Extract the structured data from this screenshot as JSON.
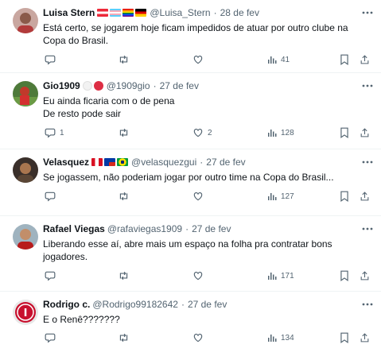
{
  "colors": {
    "text": "#0f1419",
    "secondary": "#536471",
    "divider": "#eff3f4"
  },
  "icons": {
    "more": "more-horizontal-icon",
    "reply": "reply-icon",
    "retweet": "retweet-icon",
    "like": "heart-icon",
    "views": "views-chart-icon",
    "bookmark": "bookmark-icon",
    "share": "share-icon"
  },
  "tweets": [
    {
      "name": "Luisa Stern",
      "badges": [
        "austria-flag",
        "transgender-flag",
        "rainbow-flag",
        "germany-flag"
      ],
      "handle": "@Luisa_Stern",
      "dot": "·",
      "date": "28 de fev",
      "text": "Está certo, se jogarem hoje ficam impedidos de atuar por outro clube na Copa do Brasil.",
      "replies": "",
      "retweets": "",
      "likes": "",
      "views": "41"
    },
    {
      "name": "Gio1909",
      "badges": [
        "white-circle",
        "red-circle"
      ],
      "handle": "@1909gio",
      "dot": "·",
      "date": "27 de fev",
      "text": "Eu ainda ficaria com o de pena\nDe resto pode sair",
      "replies": "1",
      "retweets": "",
      "likes": "2",
      "views": "128"
    },
    {
      "name": "Velasquez",
      "badges": [
        "peru-flag",
        "chile-flag",
        "brazil-flag"
      ],
      "handle": "@velasquezgui",
      "dot": "·",
      "date": "27 de fev",
      "text": "Se jogassem, não poderiam jogar por outro time na Copa do Brasil...",
      "replies": "",
      "retweets": "",
      "likes": "",
      "views": "127"
    },
    {
      "name": "Rafael Viegas",
      "badges": [],
      "handle": "@rafaviegas1909",
      "dot": "·",
      "date": "27 de fev",
      "text": "Liberando esse aí, abre mais um espaço na folha pra contratar bons jogadores.",
      "replies": "",
      "retweets": "",
      "likes": "",
      "views": "171"
    },
    {
      "name": "Rodrigo c.",
      "badges": [],
      "handle": "@Rodrigo99182642",
      "dot": "·",
      "date": "27 de fev",
      "text": "E o Renê???????",
      "replies": "",
      "retweets": "",
      "likes": "",
      "views": "134"
    }
  ]
}
